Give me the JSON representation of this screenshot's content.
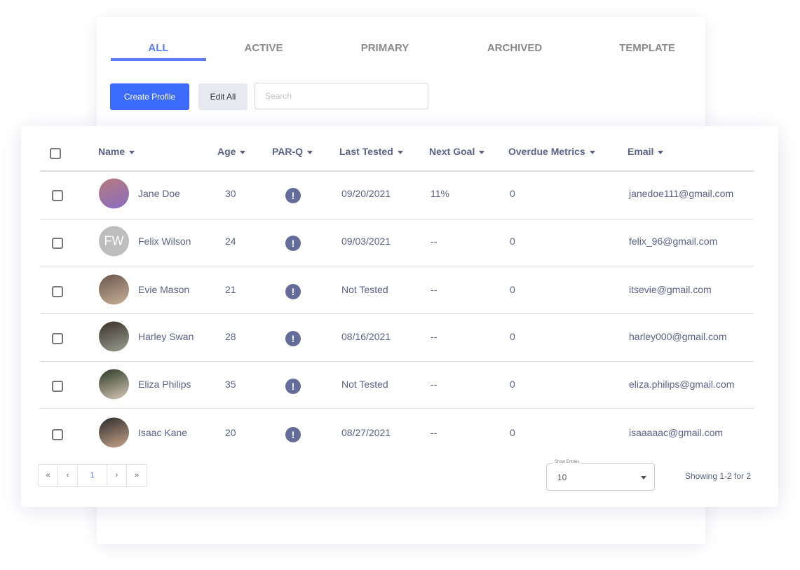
{
  "tabs": [
    {
      "label": "ALL",
      "active": true
    },
    {
      "label": "ACTIVE"
    },
    {
      "label": "PRIMARY"
    },
    {
      "label": "ARCHIVED"
    },
    {
      "label": "TEMPLATE"
    }
  ],
  "toolbar": {
    "create_label": "Create Profile",
    "edit_label": "Edit All",
    "search_placeholder": "Search"
  },
  "colors": {
    "accent": "#5b7cf6",
    "button": "#3d6bfd",
    "text": "#5b6189",
    "alert": "#646c9a"
  },
  "columns": [
    "Name",
    "Age",
    "PAR-Q",
    "Last Tested",
    "Next Goal",
    "Overdue Metrics",
    "Email"
  ],
  "rows": [
    {
      "name": "Jane Doe",
      "age": "30",
      "parq": "!",
      "last": "09/20/2021",
      "goal": "11%",
      "overdue": "0",
      "email": "janedoe111@gmail.com",
      "avatar": "photo"
    },
    {
      "name": "Felix Wilson",
      "age": "24",
      "parq": "!",
      "last": "09/03/2021",
      "goal": "--",
      "overdue": "0",
      "email": "felix_96@gmail.com",
      "initials": "FW"
    },
    {
      "name": "Evie Mason",
      "age": "21",
      "parq": "!",
      "last": "Not Tested",
      "goal": "--",
      "overdue": "0",
      "email": "itsevie@gmail.com",
      "avatar": "photo"
    },
    {
      "name": "Harley Swan",
      "age": "28",
      "parq": "!",
      "last": "08/16/2021",
      "goal": "--",
      "overdue": "0",
      "email": "harley000@gmail.com",
      "avatar": "photo"
    },
    {
      "name": "Eliza Philips",
      "age": "35",
      "parq": "!",
      "last": "Not Tested",
      "goal": "--",
      "overdue": "0",
      "email": "eliza.philips@gmail.com",
      "avatar": "photo"
    },
    {
      "name": "Isaac Kane",
      "age": "20",
      "parq": "!",
      "last": "08/27/2021",
      "goal": "--",
      "overdue": "0",
      "email": "isaaaaac@gmail.com",
      "avatar": "photo"
    }
  ],
  "pagination": {
    "first": "«",
    "prev": "‹",
    "page": "1",
    "next": "›",
    "last": "»"
  },
  "entries": {
    "label": "Show Entries",
    "value": "10"
  },
  "showing": "Showing 1-2  for 2"
}
